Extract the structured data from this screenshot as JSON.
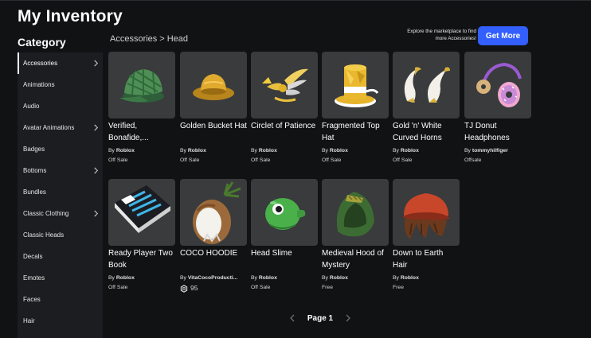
{
  "page": {
    "title": "My Inventory"
  },
  "sidebar": {
    "heading": "Category",
    "items": [
      {
        "label": "Accessories",
        "has_submenu": true,
        "active": true
      },
      {
        "label": "Animations",
        "has_submenu": false
      },
      {
        "label": "Audio",
        "has_submenu": false
      },
      {
        "label": "Avatar Animations",
        "has_submenu": true
      },
      {
        "label": "Badges",
        "has_submenu": false
      },
      {
        "label": "Bottoms",
        "has_submenu": true
      },
      {
        "label": "Bundles",
        "has_submenu": false
      },
      {
        "label": "Classic Clothing",
        "has_submenu": true
      },
      {
        "label": "Classic Heads",
        "has_submenu": false
      },
      {
        "label": "Decals",
        "has_submenu": false
      },
      {
        "label": "Emotes",
        "has_submenu": false
      },
      {
        "label": "Faces",
        "has_submenu": false
      },
      {
        "label": "Hair",
        "has_submenu": false
      }
    ]
  },
  "breadcrumb": {
    "parent": "Accessories",
    "separator": ">",
    "current": "Head"
  },
  "promo": {
    "text": "Explore the marketplace to find more Accessories!",
    "button": "Get More"
  },
  "items": [
    {
      "name": "Verified, Bonafide,...",
      "by": "By",
      "creator": "Roblox",
      "status": "Off Sale",
      "icon": "plaid-cap-icon"
    },
    {
      "name": "Golden Bucket Hat",
      "by": "By",
      "creator": "Roblox",
      "status": "Off Sale",
      "icon": "golden-bucket-hat-icon"
    },
    {
      "name": "Circlet of Patience",
      "by": "By",
      "creator": "Roblox",
      "status": "Off Sale",
      "icon": "winged-circlet-icon"
    },
    {
      "name": "Fragmented Top Hat",
      "by": "By",
      "creator": "Roblox",
      "status": "Off Sale",
      "icon": "top-hat-icon"
    },
    {
      "name": "Gold 'n' White Curved Horns",
      "by": "By",
      "creator": "Roblox",
      "status": "Off Sale",
      "icon": "curved-horns-icon"
    },
    {
      "name": "TJ Donut Headphones",
      "by": "By",
      "creator": "tommyhilfiger",
      "status": "Offsale",
      "icon": "donut-headphones-icon"
    },
    {
      "name": "Ready Player Two Book",
      "by": "By",
      "creator": "Roblox",
      "status": "Off Sale",
      "icon": "book-icon"
    },
    {
      "name": "COCO HOODIE",
      "by": "By",
      "creator": "VitaCocoProducti...",
      "price": "95",
      "icon": "coconut-hoodie-icon"
    },
    {
      "name": "Head Slime",
      "by": "By",
      "creator": "Roblox",
      "status": "Off Sale",
      "icon": "slime-icon"
    },
    {
      "name": "Medieval Hood of Mystery",
      "by": "By",
      "creator": "Roblox",
      "status": "Free",
      "icon": "hood-icon"
    },
    {
      "name": "Down to Earth Hair",
      "by": "By",
      "creator": "Roblox",
      "status": "Free",
      "icon": "hair-icon"
    }
  ],
  "pagination": {
    "label": "Page 1"
  },
  "colors": {
    "background": "#111214",
    "sidebar": "#1c1d20",
    "card": "#393b3d",
    "accent": "#335fff"
  }
}
